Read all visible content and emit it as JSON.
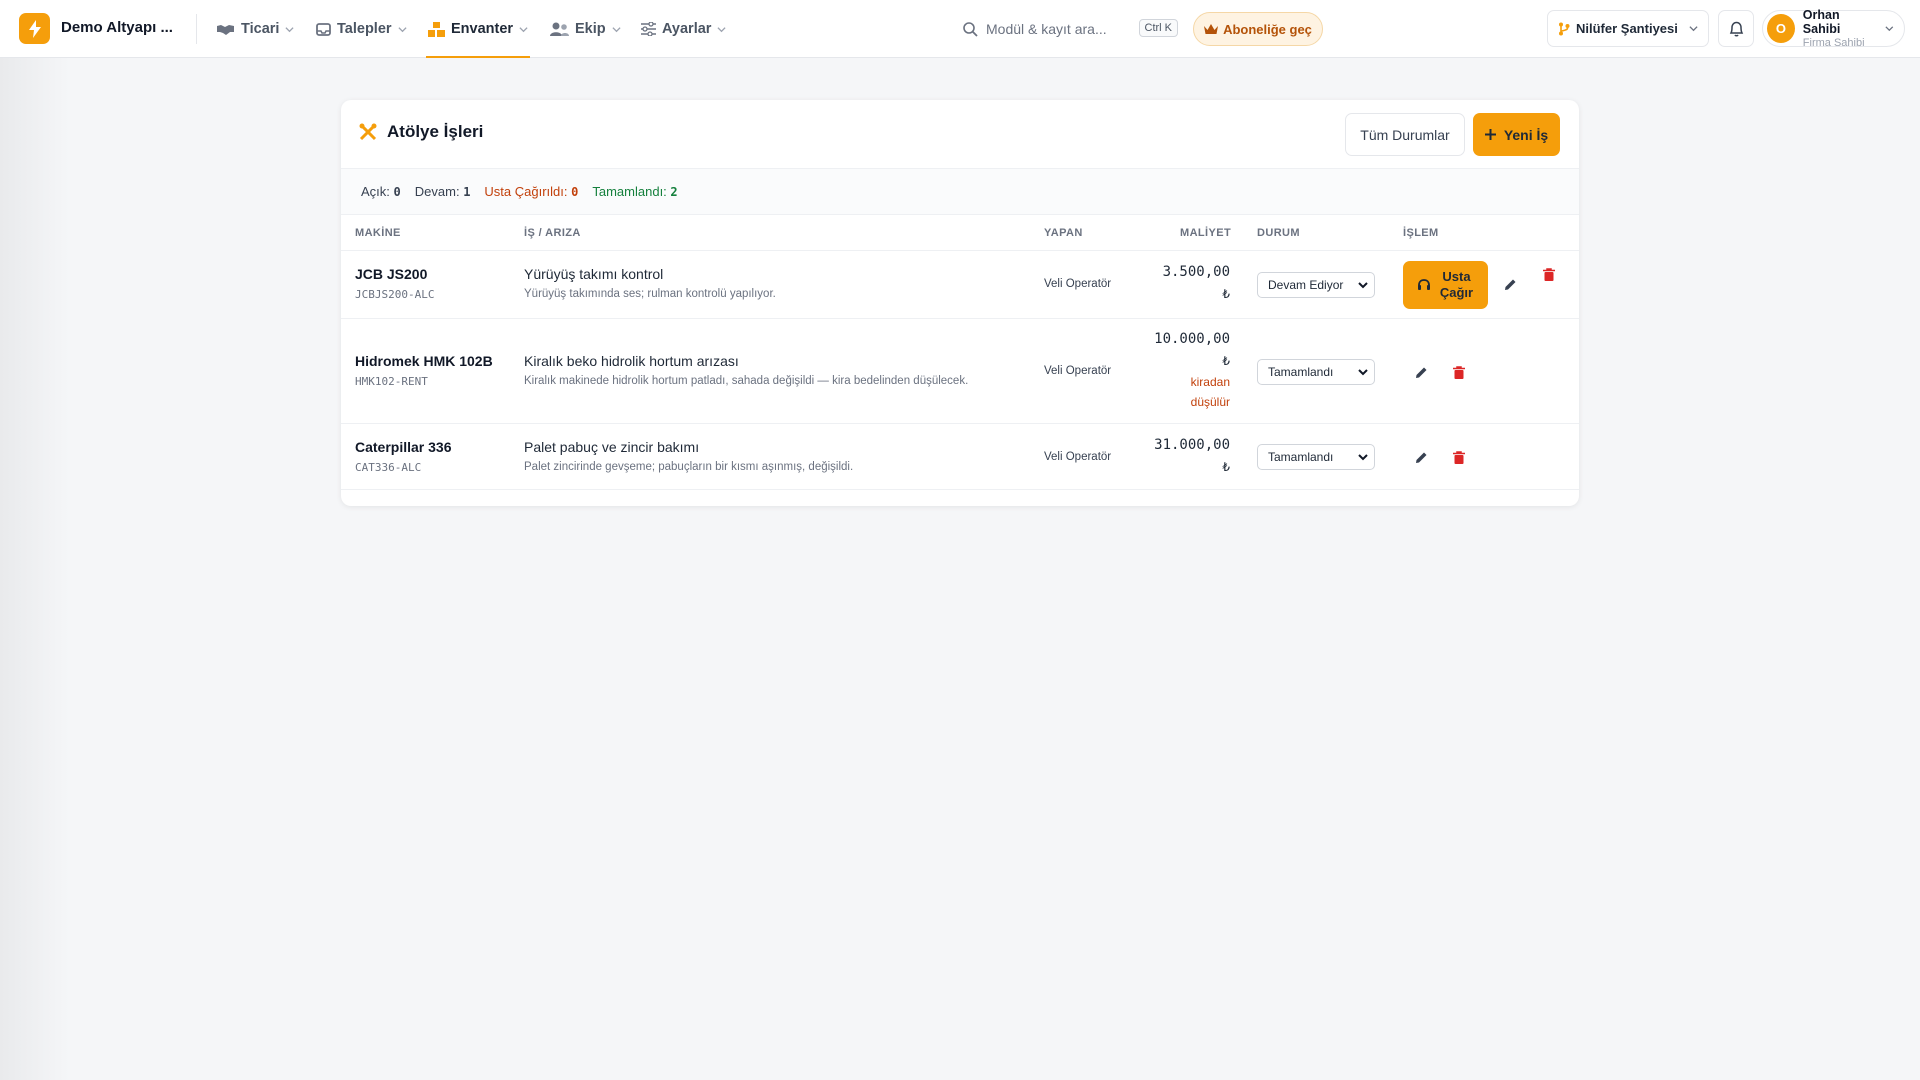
{
  "app": {
    "brand": "Demo Altyapı ...",
    "accent": "#f59e0b"
  },
  "nav": {
    "items": [
      {
        "label": "Ticari",
        "icon": "handshake-icon"
      },
      {
        "label": "Talepler",
        "icon": "inbox-icon"
      },
      {
        "label": "Envanter",
        "icon": "boxes-icon",
        "active": true
      },
      {
        "label": "Ekip",
        "icon": "users-icon"
      },
      {
        "label": "Ayarlar",
        "icon": "sliders-icon"
      }
    ]
  },
  "search": {
    "placeholder": "Modül & kayıt ara...",
    "shortcut": "Ctrl K"
  },
  "subscribe": {
    "label": "Aboneliğe geç"
  },
  "site": {
    "label": "Nilüfer Şantiyesi"
  },
  "user": {
    "initial": "O",
    "name": "Orhan Sahibi",
    "role": "Firma Sahibi"
  },
  "card": {
    "title": "Atölye İşleri",
    "filter_label": "Tüm Durumlar",
    "new_label": "Yeni İş"
  },
  "summary": {
    "open_label": "Açık:",
    "open_value": "0",
    "progress_label": "Devam:",
    "progress_value": "1",
    "called_label": "Usta Çağırıldı:",
    "called_value": "0",
    "done_label": "Tamamlandı:",
    "done_value": "2"
  },
  "table": {
    "headers": {
      "machine": "MAKİNE",
      "job": "İŞ / ARIZA",
      "worker": "YAPAN",
      "cost": "MALİYET",
      "status": "DURUM",
      "action": "İŞLEM"
    },
    "rows": [
      {
        "machine": "JCB JS200",
        "code": "JCBJS200-ALC",
        "job_title": "Yürüyüş takımı kontrol",
        "job_desc": "Yürüyüş takımında ses; rulman kontrolü yapılıyor.",
        "worker": "Veli Operatör",
        "cost": "3.500,00",
        "currency": "₺",
        "cost_note": "",
        "status": "Devam Ediyor",
        "call_label": "Usta Çağır"
      },
      {
        "machine": "Hidromek HMK 102B",
        "code": "HMK102-RENT",
        "job_title": "Kiralık beko hidrolik hortum arızası",
        "job_desc": "Kiralık makinede hidrolik hortum patladı, sahada değişildi — kira bedelinden düşülecek.",
        "worker": "Veli Operatör",
        "cost": "10.000,00",
        "currency": "₺",
        "cost_note_1": "kiradan",
        "cost_note_2": "düşülür",
        "status": "Tamamlandı"
      },
      {
        "machine": "Caterpillar 336",
        "code": "CAT336-ALC",
        "job_title": "Palet pabuç ve zincir bakımı",
        "job_desc": "Palet zincirinde gevşeme; pabuçların bir kısmı aşınmış, değişildi.",
        "worker": "Veli Operatör",
        "cost": "31.000,00",
        "currency": "₺",
        "status": "Tamamlandı"
      }
    ]
  }
}
